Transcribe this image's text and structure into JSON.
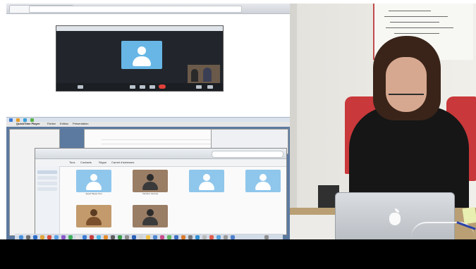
{
  "screen": {
    "browser": {},
    "skype_call": {
      "contact_name": "",
      "colors": {
        "avatar": "#67b6e6",
        "end_call": "#e0413b"
      }
    },
    "mac": {
      "menubar": {
        "app_name": "QuickTime Player",
        "items": [
          "Fichier",
          "Edition",
          "Présentation"
        ]
      },
      "contacts_window": {
        "tabs": [
          "Tous",
          "Contacts",
          "Skype",
          "Carnet d'adresses"
        ],
        "cards": [
          {
            "name": "Appel Skype Test",
            "icon": "default-avatar"
          },
          {
            "name": "Caroline Lacoste",
            "icon": "photo-avatar"
          },
          {
            "name": "",
            "icon": "default-avatar"
          },
          {
            "name": "",
            "icon": "default-avatar"
          },
          {
            "name": "",
            "icon": "photo-avatar"
          },
          {
            "name": "",
            "icon": "photo-avatar"
          }
        ]
      }
    }
  },
  "camera_feed": {
    "scene": "presenter-at-laptop",
    "laptop_logo": "apple-icon"
  }
}
